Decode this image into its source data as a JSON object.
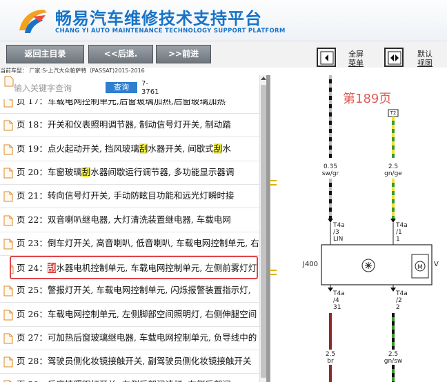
{
  "header": {
    "title": "畅易汽车维修技术支持平台",
    "subtitle": "CHANG YI AUTO MAINTENANCE TECHNOLOGY SUPPORT PLATFORM",
    "brand_color": "#1673c8"
  },
  "toolbar": {
    "home_label": "返回主目录",
    "back_label": "<<后退.",
    "forward_label": ">>前进",
    "fullscreen_line1": "全屏",
    "fullscreen_line2": "菜单",
    "default_line1": "默认",
    "default_line2": "视图"
  },
  "current_model": "当前车型： 厂家:S-上汽大众帕萨特（PASSAT)2015-2016",
  "search": {
    "placeholder": "输入关键字查询",
    "button": "查询",
    "range_line1": "7-",
    "range_line2": "3761"
  },
  "list": [
    {
      "prefix": "页 17：",
      "text": "车载电网控制单元,后窗玻璃加热,后窗玻璃加热"
    },
    {
      "prefix": "页 18：",
      "text": "开关和仪表照明调节器, 制动信号灯开关, 制动踏"
    },
    {
      "prefix": "页 19：",
      "text_before": "点火起动开关, 挡风玻璃",
      "hl": "刮",
      "text_mid": "水器开关, 间歇式",
      "hl2": "刮",
      "text_after": "水"
    },
    {
      "prefix": "页 20：",
      "text_before": "车窗玻璃",
      "hl": "刮",
      "text_after": "水器间歇运行调节器, 多功能显示器调"
    },
    {
      "prefix": "页 21：",
      "text": "转向信号灯开关, 手动防眩目功能和远光灯瞬时接"
    },
    {
      "prefix": "页 22：",
      "text": "双音喇叭继电器, 大灯清洗装置继电器, 车载电网"
    },
    {
      "prefix": "页 23：",
      "text": "倒车灯开关, 高音喇叭, 低音喇叭, 车载电网控制单元, 右"
    },
    {
      "prefix": "页 24：",
      "hl_red": "刮",
      "text_after": "水器电机控制单元, 车载电网控制单元, 左侧前雾灯灯",
      "selected": true
    },
    {
      "prefix": "页 25：",
      "text": "警报灯开关, 车载电网控制单元, 闪烁报警装置指示灯,"
    },
    {
      "prefix": "页 26：",
      "text": "车载电网控制单元, 左侧脚部空间照明灯, 右侧伸腿空间"
    },
    {
      "prefix": "页 27：",
      "text": "可加热后窗玻璃继电器, 车载电网控制单元, 负导线中的"
    },
    {
      "prefix": "页 28：",
      "text": "驾驶员侧化妆镜接触开关, 副驾驶员侧化妆镜接触开关"
    },
    {
      "prefix": "页 29：",
      "text": "后座椅照明灯开关, 左侧后部阅读灯, 右侧后部阅"
    }
  ],
  "diagram": {
    "page_label": "第189页",
    "top_connector": "T2",
    "wire_left_top": {
      "size": "0.35",
      "color": "sw/gr"
    },
    "wire_right_top": {
      "size": "2.5",
      "color": "gn/ge"
    },
    "pin_left_top": {
      "conn": "T4a",
      "pin": "/3",
      "name": "LIN"
    },
    "pin_right_top": {
      "conn": "T4a",
      "pin": "/1",
      "name": "1"
    },
    "component": "J400",
    "motor_label": "V",
    "pin_left_bottom": {
      "conn": "T4a",
      "pin": "/4",
      "name": "31"
    },
    "pin_right_bottom": {
      "conn": "T4a",
      "pin": "/2",
      "name": "2"
    },
    "wire_left_bottom": {
      "size": "2.5",
      "color": "br"
    },
    "wire_right_bottom": {
      "size": "2.5",
      "color": "gn/sw"
    }
  }
}
